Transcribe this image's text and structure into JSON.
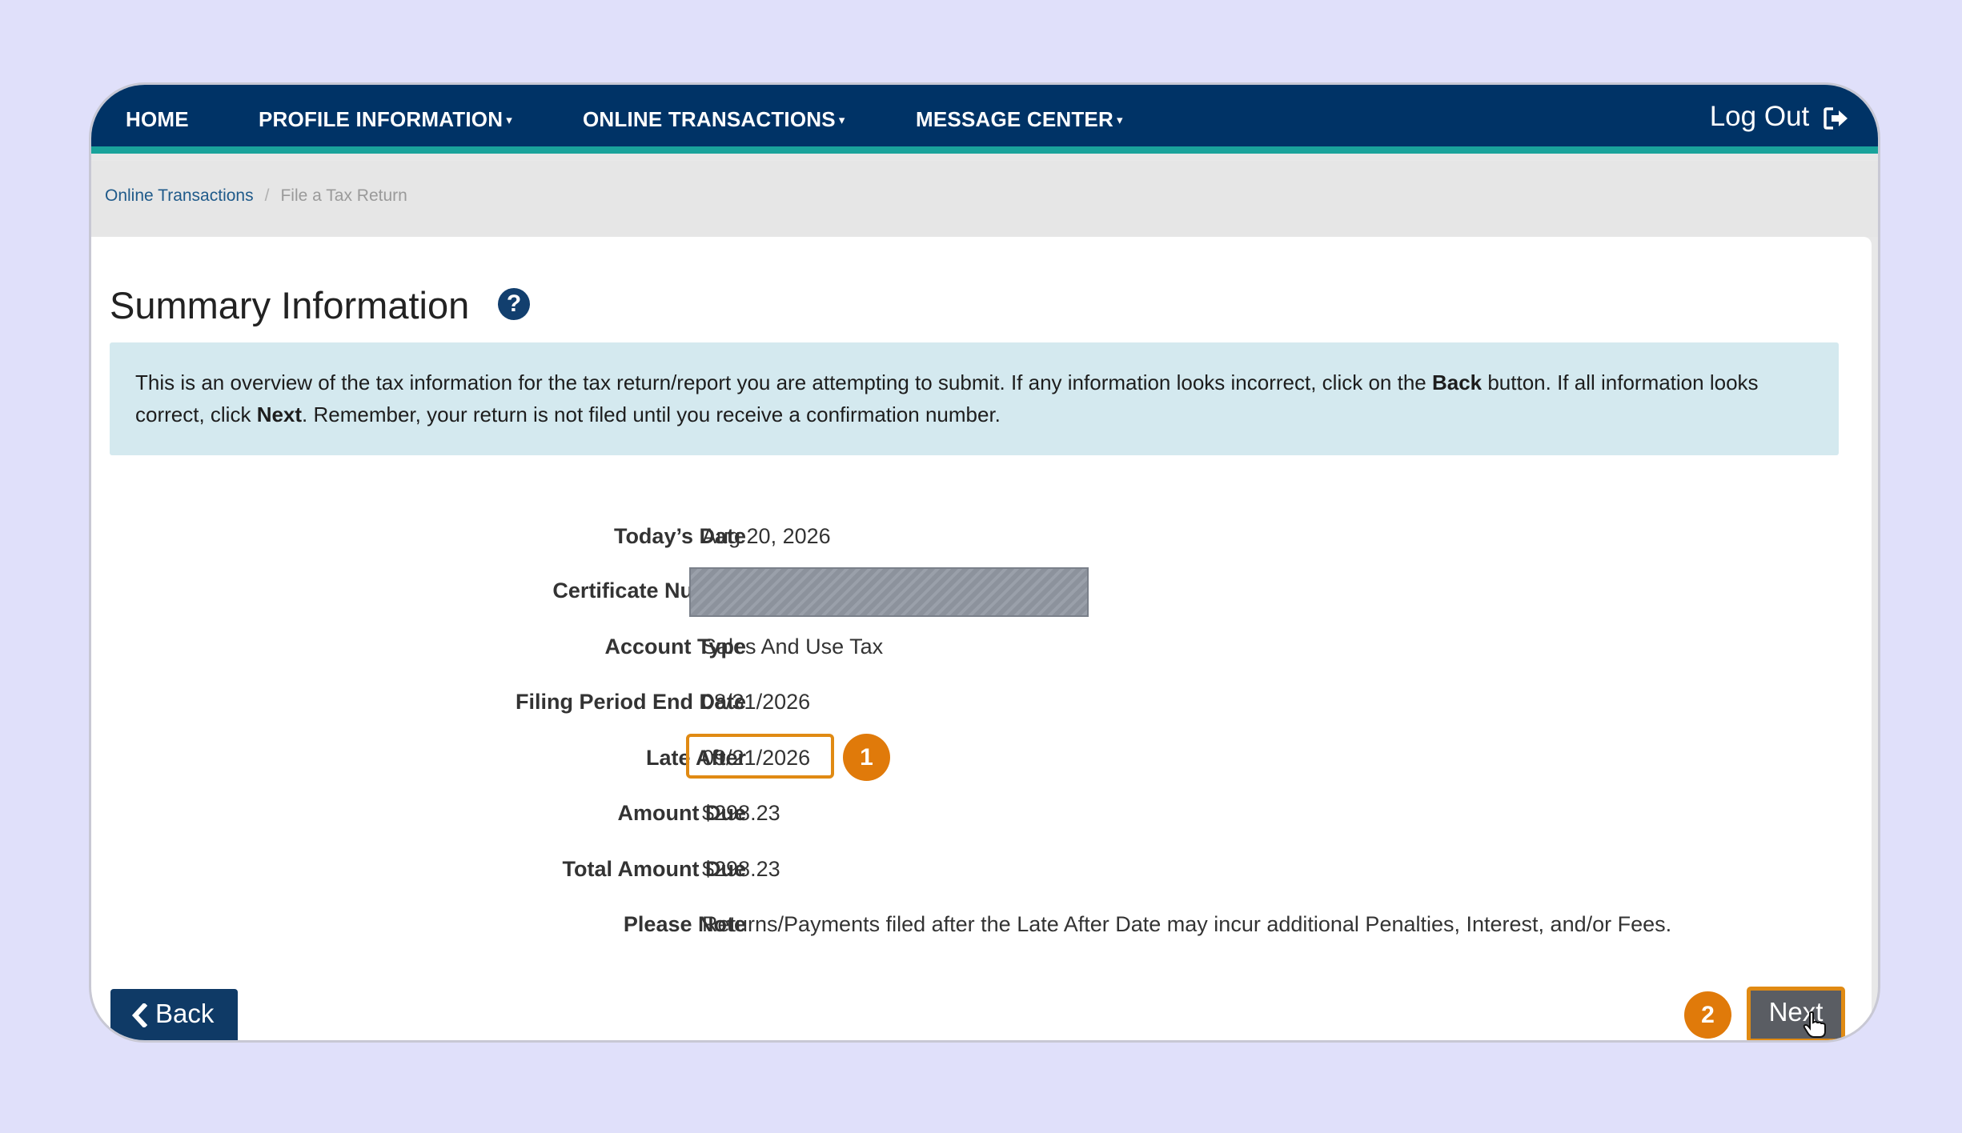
{
  "nav": {
    "home": "HOME",
    "profile": "PROFILE INFORMATION",
    "transactions": "ONLINE TRANSACTIONS",
    "messages": "MESSAGE CENTER",
    "caret": "▾",
    "logout": "Log Out"
  },
  "breadcrumb": {
    "link": "Online Transactions",
    "separator": "/",
    "current": "File a Tax Return"
  },
  "page": {
    "title": "Summary Information",
    "help": "?"
  },
  "info": {
    "part1": "This is an overview of the tax information for the tax return/report you are attempting to submit. If any information looks incorrect, click on the ",
    "back_word": "Back",
    "part2": " button. If all information looks correct, click ",
    "next_word": "Next",
    "part3": ". Remember, your return is not filed until you receive a confirmation number."
  },
  "summary": {
    "todays_date_label": "Today’s Date",
    "todays_date": "Aug 20, 2026",
    "certificate_label": "Certificate Number",
    "account_type_label": "Account Type",
    "account_type": "Sales And Use Tax",
    "filing_period_label": "Filing Period End Date",
    "filing_period": "08/31/2026",
    "late_after_label": "Late After",
    "late_after": "09/21/2026",
    "amount_due_label": "Amount Due",
    "amount_due": "$298.23",
    "total_due_label": "Total Amount Due",
    "total_due": "$298.23",
    "note_label": "Please Note",
    "note": "Returns/Payments filed after the Late After Date may incur additional Penalties, Interest, and/or Fees."
  },
  "badges": {
    "one": "1",
    "two": "2"
  },
  "buttons": {
    "back": "Back",
    "next": "Next"
  },
  "colors": {
    "navbar": "#003366",
    "nav_accent": "#1aa39b",
    "highlight": "#e08a13",
    "info_bg": "#d4e9ef"
  },
  "icons": {
    "help": "question-circle-icon",
    "logout": "sign-out-icon",
    "back": "chevron-left-icon",
    "cursor": "hand-pointer-icon"
  }
}
